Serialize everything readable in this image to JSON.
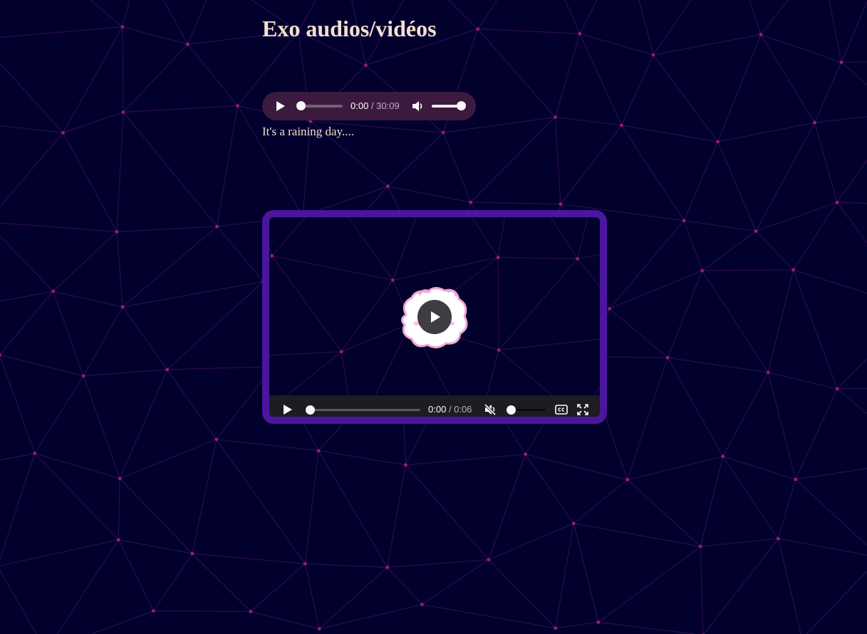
{
  "page": {
    "title": "Exo audios/vidéos",
    "background_color": "#02012e",
    "accent_color": "#4b169e",
    "net_color": "#5a1a6e"
  },
  "audio": {
    "current_time": "0:00",
    "duration": "/ 30:09",
    "progress": 0,
    "volume": 1.0,
    "play_icon": "play-icon",
    "volume_icon": "speaker-volume-icon"
  },
  "caption": "It's a raining day....",
  "video": {
    "current_time": "0:00",
    "duration": "/ 0:06",
    "progress": 0,
    "volume": 0,
    "muted": true,
    "poster_icon": "sheep-sticker",
    "icons": [
      "play-icon",
      "muted-speaker-icon",
      "captions-icon",
      "fullscreen-icon"
    ]
  }
}
